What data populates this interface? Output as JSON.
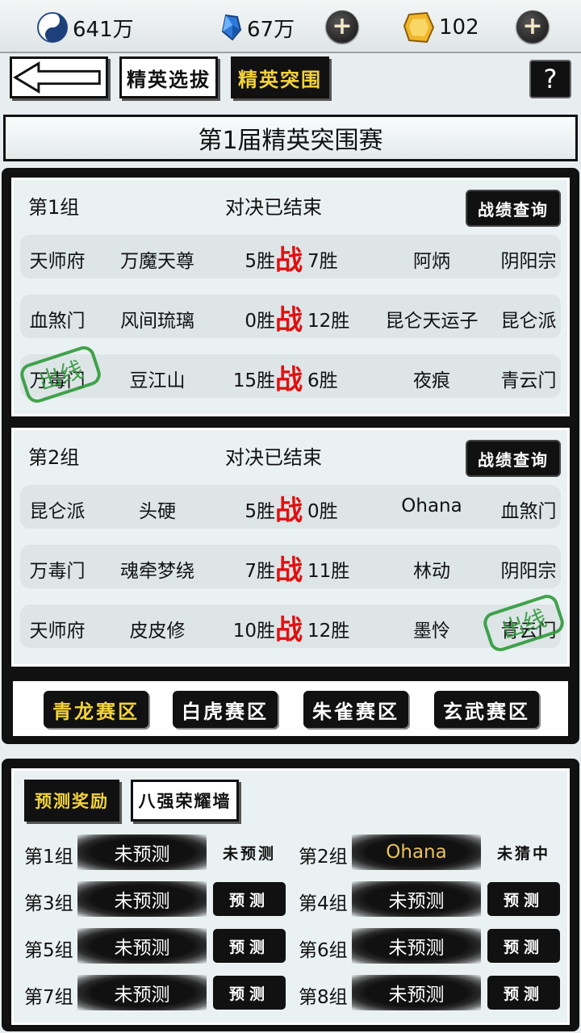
{
  "resources": {
    "taiji": {
      "value": "641万",
      "icon": "yin-yang-icon"
    },
    "crystal": {
      "value": "67万",
      "icon": "blue-crystal-icon"
    },
    "gold": {
      "value": "102",
      "icon": "gold-gem-icon"
    },
    "plus_symbol": "+"
  },
  "nav": {
    "tabs": [
      {
        "label": "精英选拔",
        "active": false
      },
      {
        "label": "精英突围",
        "active": true
      }
    ],
    "help_label": "?"
  },
  "page_title": "第1届精英突围赛",
  "groups": [
    {
      "name": "第1组",
      "status": "对决已结束",
      "record_label": "战绩查询",
      "matches": [
        {
          "sect1": "天师府",
          "name1": "万魔天尊",
          "wins1": "5胜",
          "vs": "战",
          "wins2": "7胜",
          "name2": "阿炳",
          "sect2": "阴阳宗"
        },
        {
          "sect1": "血煞门",
          "name1": "风间琉璃",
          "wins1": "0胜",
          "vs": "战",
          "wins2": "12胜",
          "name2": "昆仑天运子",
          "sect2": "昆仑派"
        },
        {
          "sect1": "万毒门",
          "name1": "豆江山",
          "wins1": "15胜",
          "vs": "战",
          "wins2": "6胜",
          "name2": "夜痕",
          "sect2": "青云门"
        }
      ]
    },
    {
      "name": "第2组",
      "status": "对决已结束",
      "record_label": "战绩查询",
      "matches": [
        {
          "sect1": "昆仑派",
          "name1": "头硬",
          "wins1": "5胜",
          "vs": "战",
          "wins2": "0胜",
          "name2": "Ohana",
          "sect2": "血煞门"
        },
        {
          "sect1": "万毒门",
          "name1": "魂牵梦绕",
          "wins1": "7胜",
          "vs": "战",
          "wins2": "11胜",
          "name2": "林动",
          "sect2": "阴阳宗"
        },
        {
          "sect1": "天师府",
          "name1": "皮皮修",
          "wins1": "10胜",
          "vs": "战",
          "wins2": "12胜",
          "name2": "墨怜",
          "sect2": "青云门"
        }
      ]
    }
  ],
  "stamp_text": "出线",
  "regions": [
    {
      "label": "青龙赛区",
      "active": true
    },
    {
      "label": "白虎赛区",
      "active": false
    },
    {
      "label": "朱雀赛区",
      "active": false
    },
    {
      "label": "玄武赛区",
      "active": false
    }
  ],
  "prediction": {
    "tabs": [
      {
        "label": "预测奖励",
        "active": true
      },
      {
        "label": "八强荣耀墙",
        "active": false
      }
    ],
    "rows": [
      {
        "group": "第1组",
        "pick": "未预测",
        "action": "未预测"
      },
      {
        "group": "第2组",
        "pick": "Ohana",
        "action": "未猜中"
      },
      {
        "group": "第3组",
        "pick": "未预测",
        "action": "预测"
      },
      {
        "group": "第4组",
        "pick": "未预测",
        "action": "预测"
      },
      {
        "group": "第5组",
        "pick": "未预测",
        "action": "预测"
      },
      {
        "group": "第6组",
        "pick": "未预测",
        "action": "预测"
      },
      {
        "group": "第7组",
        "pick": "未预测",
        "action": "预测"
      },
      {
        "group": "第8组",
        "pick": "未预测",
        "action": "预测"
      }
    ]
  }
}
